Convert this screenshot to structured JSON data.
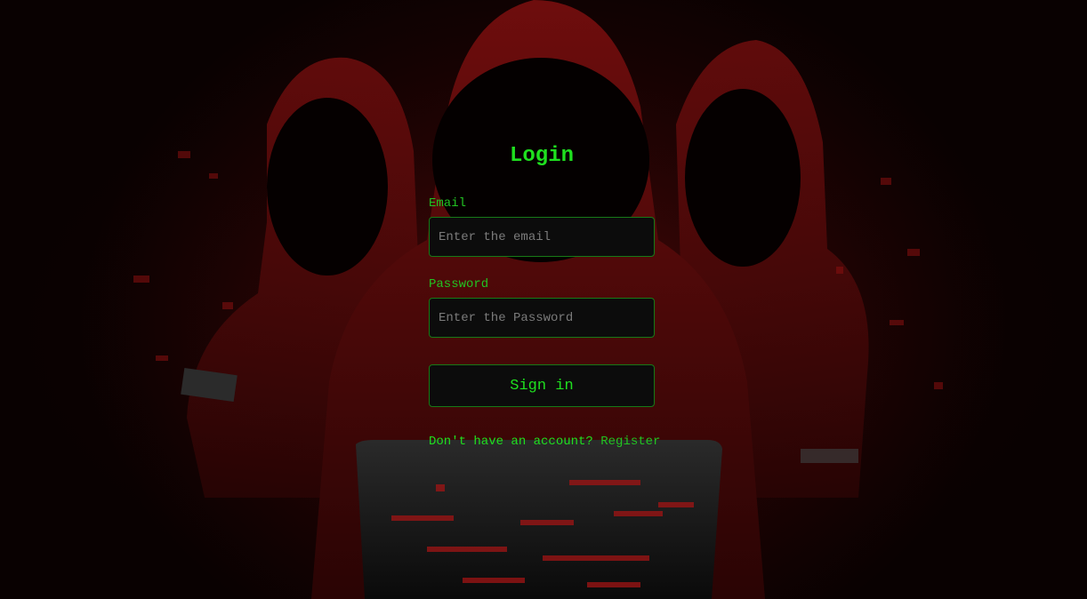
{
  "login": {
    "title": "Login",
    "email_label": "Email",
    "email_placeholder": "Enter the email",
    "email_value": "",
    "password_label": "Password",
    "password_placeholder": "Enter the Password",
    "password_value": "",
    "submit_label": "Sign in",
    "register_prompt": "Don't have an account? ",
    "register_link": "Register"
  },
  "colors": {
    "accent_green": "#1fe01f",
    "input_border": "#177a17",
    "input_bg": "#0c0c0c",
    "background_red": "#3a0606"
  },
  "background": {
    "image_subject": "hooded-hackers-illustration"
  }
}
